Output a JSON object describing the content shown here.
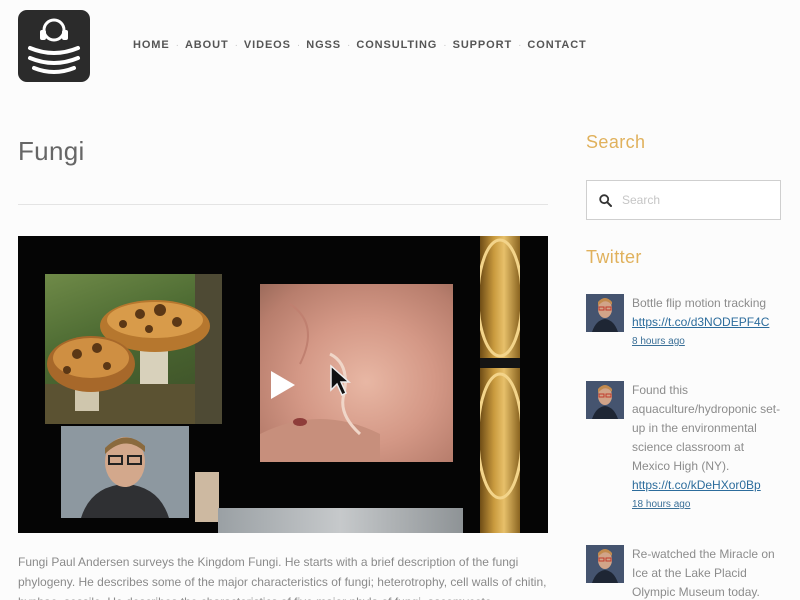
{
  "header": {
    "logo_icon": "headphones-signal-logo-icon",
    "nav": [
      "HOME",
      "ABOUT",
      "VIDEOS",
      "NGSS",
      "CONSULTING",
      "SUPPORT",
      "CONTACT"
    ]
  },
  "main": {
    "title": "Fungi",
    "video": {
      "play_icon": "play-icon",
      "cursor_icon": "cursor-icon"
    },
    "description": "Fungi Paul Andersen surveys the Kingdom Fungi. He starts with a brief description of the fungi phylogeny. He describes some of the major characteristics of fungi; heterotrophy, cell walls of chitin, hyphae, sessile. He describes the characteristics of five major phyla of fungi, ascomycete"
  },
  "sidebar": {
    "search": {
      "heading": "Search",
      "placeholder": "Search",
      "icon": "search-icon"
    },
    "twitter": {
      "heading": "Twitter",
      "tweets": [
        {
          "text": "Bottle flip motion tracking",
          "link": "https://t.co/d3NODEPF4C",
          "time": "8 hours ago"
        },
        {
          "text": "Found this aquaculture/hydroponic set-up in the environmental science classroom at Mexico High (NY).",
          "link": "https://t.co/kDeHXor0Bp",
          "time": "18 hours ago"
        },
        {
          "text": "Re-watched the Miracle on Ice at the Lake Placid Olympic Museum today.",
          "link": "",
          "time": ""
        }
      ]
    }
  },
  "colors": {
    "accent": "#e0b15c",
    "link": "#2c6c9c",
    "logo_bg": "#2b2b2b"
  }
}
